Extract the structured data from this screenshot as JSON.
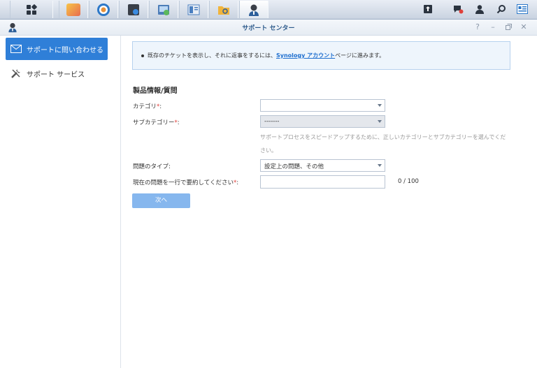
{
  "window": {
    "title": "サポート センター"
  },
  "sidebar": {
    "items": [
      {
        "label": "サポートに問い合わせる",
        "active": true
      },
      {
        "label": "サポート サービス",
        "active": false
      }
    ]
  },
  "notice": {
    "prefix": "既存のチケットを表示し、それに返事をするには、",
    "link": "Synology アカウント",
    "suffix": "ページに進みます。"
  },
  "form": {
    "section_title": "製品情報/質問",
    "category_label": "カテゴリ",
    "category_value": "",
    "subcategory_label": "サブカテゴリー",
    "subcategory_value": "-------",
    "hint": "サポートプロセスをスピードアップするために、正しいカテゴリーとサブカテゴリーを選んでください。",
    "issue_type_label": "問題のタイプ:",
    "issue_type_value": "設定上の問題、その他",
    "summary_label": "現在の問題を一行で要約してください",
    "summary_value": "",
    "counter": "0 / 100",
    "next_label": "次へ",
    "required_mark": "*",
    "colon": ":"
  },
  "colors": {
    "accent": "#2f7fd8",
    "button": "#86b7ee",
    "notice_bg": "#eef5fc"
  }
}
